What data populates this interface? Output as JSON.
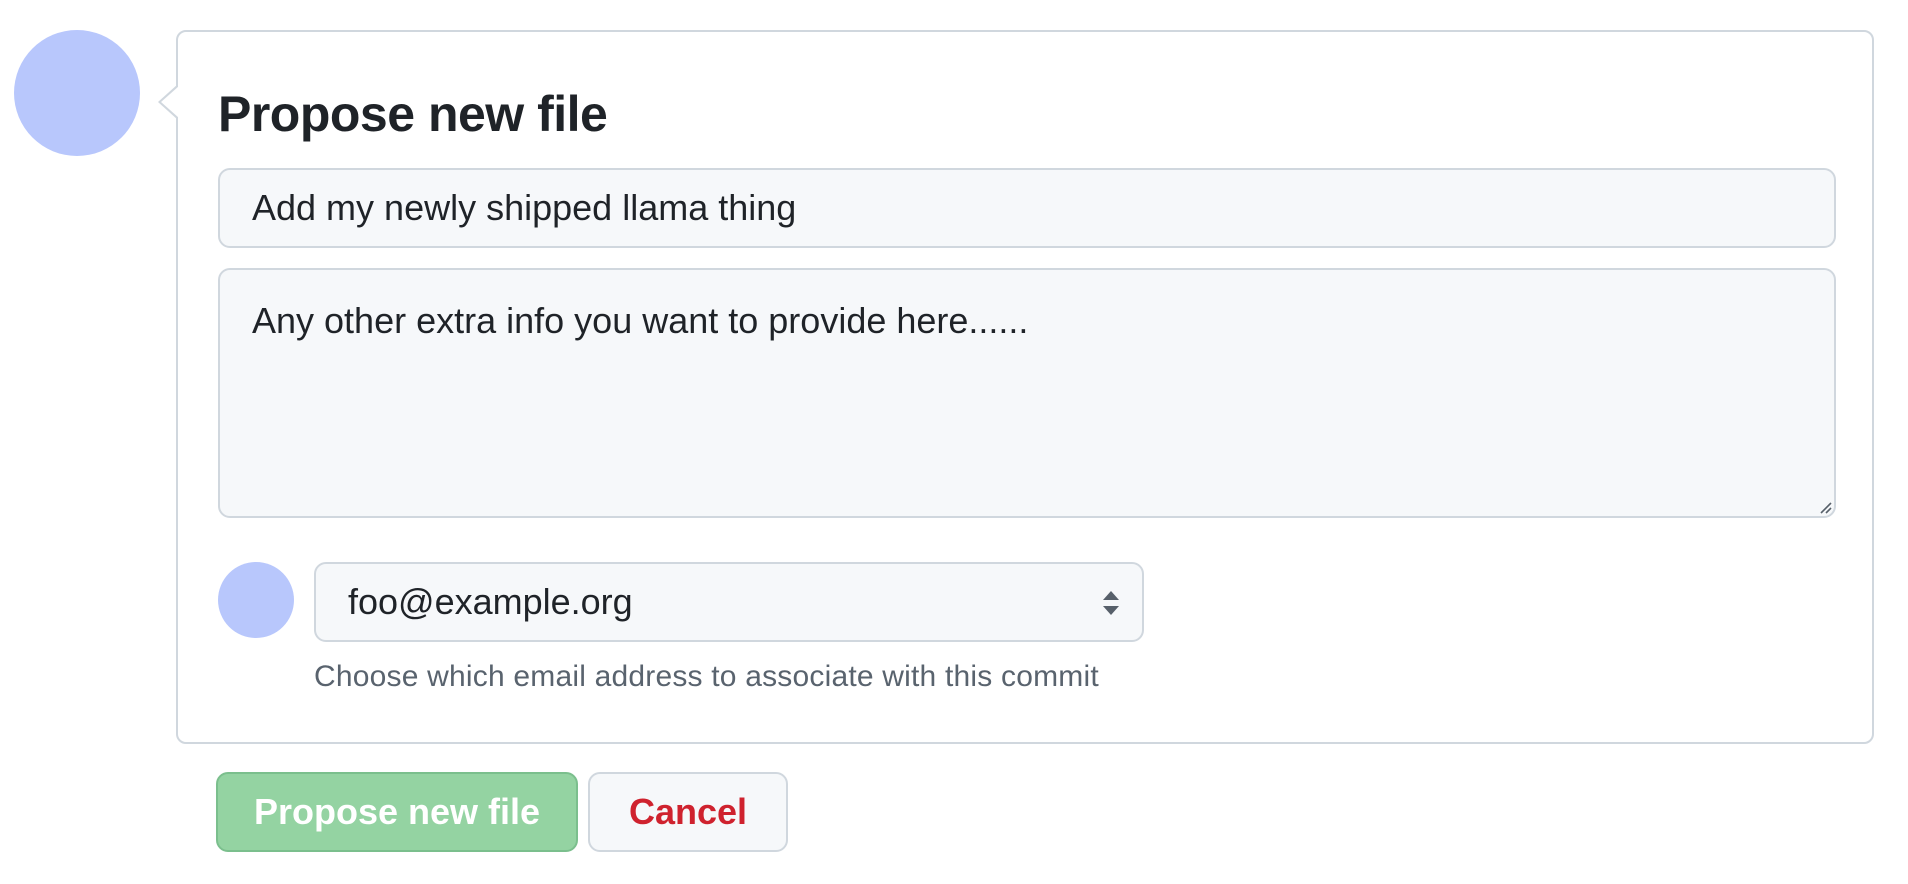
{
  "form": {
    "title": "Propose new file",
    "summary_value": "Add my newly shipped llama thing",
    "description_value": "Any other extra info you want to provide here......",
    "email_selected": "foo@example.org",
    "email_hint": "Choose which email address to associate with this commit"
  },
  "actions": {
    "propose_label": "Propose new file",
    "cancel_label": "Cancel"
  },
  "icons": {
    "select_arrows": "up-down-caret-icon",
    "resize_handle": "resize-grip-icon"
  },
  "colors": {
    "avatar": "#b8c7fc",
    "primary_button": "#94d3a2",
    "cancel_text": "#cf222e",
    "border": "#d0d7de",
    "field_bg": "#f6f8fa",
    "hint_text": "#59636e"
  }
}
